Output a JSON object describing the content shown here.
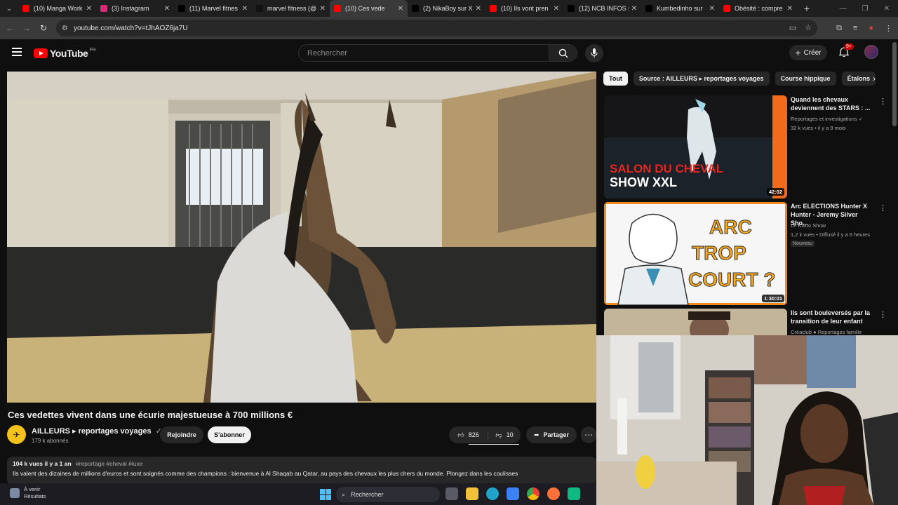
{
  "browser": {
    "tabs": [
      {
        "label": "(10) Manga Work",
        "fav": "#ff0000",
        "icon": "youtube-icon"
      },
      {
        "label": "(3) Instagram",
        "fav": "#d62976",
        "icon": "instagram-icon"
      },
      {
        "label": "(11) Marvel fitnes",
        "fav": "#000000",
        "icon": "x-icon"
      },
      {
        "label": "marvel fitness (@",
        "fav": "#111111",
        "icon": "tiktok-icon"
      },
      {
        "label": "(10) Ces vede",
        "fav": "#ff0000",
        "icon": "youtube-icon",
        "active": true
      },
      {
        "label": "(2) NikaBoy sur X",
        "fav": "#000000",
        "icon": "x-icon"
      },
      {
        "label": "(10) Ils vont pren",
        "fav": "#ff0000",
        "icon": "youtube-icon"
      },
      {
        "label": "(12) NCB INFOS s",
        "fav": "#000000",
        "icon": "x-icon"
      },
      {
        "label": "Kumbedinho sur",
        "fav": "#000000",
        "icon": "x-icon"
      },
      {
        "label": "Obésité : compre",
        "fav": "#ff0000",
        "icon": "youtube-icon"
      }
    ],
    "url": "youtube.com/watch?v=tJhAOZ6ja7U"
  },
  "header": {
    "logo_text": "YouTube",
    "logo_country": "FR",
    "search_placeholder": "Rechercher",
    "create_label": "Créer",
    "notif_count": "9+"
  },
  "video": {
    "title": "Ces vedettes vivent dans une écurie majestueuse à 700 millions €",
    "channel_name": "AILLEURS ▸ reportages voyages",
    "channel_subs": "179 k abonnés",
    "join_label": "Rejoindre",
    "subscribe_label": "S'abonner",
    "likes": "826",
    "dislikes": "10",
    "share_label": "Partager",
    "views_date": "104 k vues  il y a 1 an",
    "tags": "#reportage #cheval #luxe",
    "description": "Ils valent des dizaines de millions d'euros et sont soignés comme des champions : bienvenue à Al Shaqab au Qatar, au pays des chevaux les plus chers du monde. Plongez dans les coulisses"
  },
  "chips": [
    "Tout",
    "Source : AILLEURS ▸ reportages voyages",
    "Course hippique",
    "Étalons"
  ],
  "recommendations": [
    {
      "title": "Quand les chevaux deviennent des STARS : ...",
      "channel": "Reportages et investigations ✓",
      "meta": "32 k vues • il y a 9 mois",
      "duration": "42:02",
      "thumb_line1": "SALON DU CHEVAL",
      "thumb_line2": "SHOW XXL"
    },
    {
      "title": "Arc ELECTIONS Hunter X Hunter - Jeremy Silver Sho...",
      "channel": "Le Kikoo Show",
      "meta": "1,2 k vues • Diffusé il y a 6 heures",
      "badge": "Nouveau",
      "duration": "1:30:01",
      "thumb_line1": "ARC",
      "thumb_line2": "TROP",
      "thumb_line3": "COURT ?"
    },
    {
      "title": "Ils sont bouleversés par la transition de leur enfant",
      "channel": "Créaclub ● Reportages famille",
      "meta": "",
      "duration": ""
    }
  ],
  "taskbar": {
    "weather_title": "À venir",
    "weather_sub": "Résultats",
    "search_label": "Rechercher"
  },
  "colors": {
    "yt_red": "#ff0000",
    "bg": "#0f0f0f",
    "chip_bg": "#272727",
    "subscribe_bg": "#f1f1f1"
  }
}
